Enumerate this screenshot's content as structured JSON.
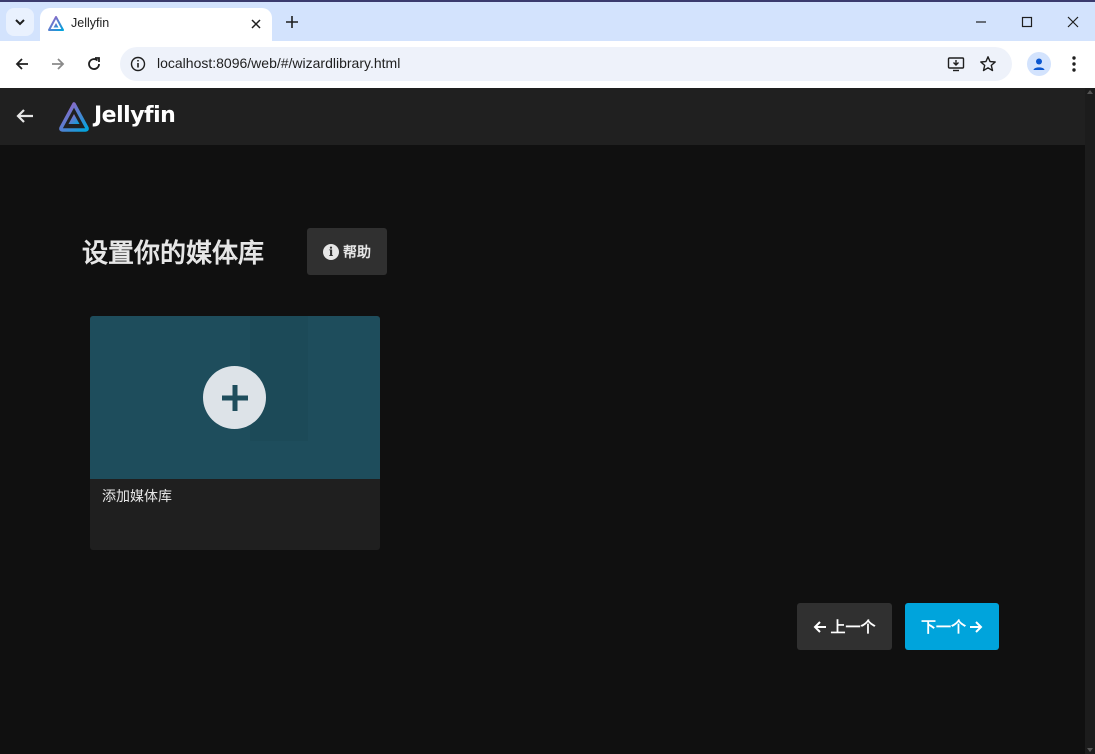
{
  "browser": {
    "tab_title": "Jellyfin",
    "url": "localhost:8096/web/#/wizardlibrary.html",
    "icons": {
      "tab_menu": "chevron-down-icon",
      "favicon": "jellyfin-favicon",
      "tab_close": "close-icon",
      "new_tab": "plus-icon",
      "minimize": "minimize-icon",
      "maximize": "maximize-icon",
      "close": "close-icon",
      "back": "arrow-left-icon",
      "forward": "arrow-right-icon",
      "reload": "reload-icon",
      "site_info": "info-icon",
      "install": "install-app-icon",
      "bookmark": "star-icon",
      "profile": "profile-icon",
      "menu": "kebab-menu-icon"
    }
  },
  "app": {
    "logo_text": "Jellyfin",
    "colors": {
      "accent": "#00a4dc",
      "header_bg": "#202020",
      "page_bg": "#101010",
      "card_image_bg": "#1e4d5c",
      "button_bg": "#303030"
    }
  },
  "wizard": {
    "title": "设置你的媒体库",
    "help_label": "帮助",
    "add_library_label": "添加媒体库",
    "prev_label": "上一个",
    "next_label": "下一个"
  }
}
